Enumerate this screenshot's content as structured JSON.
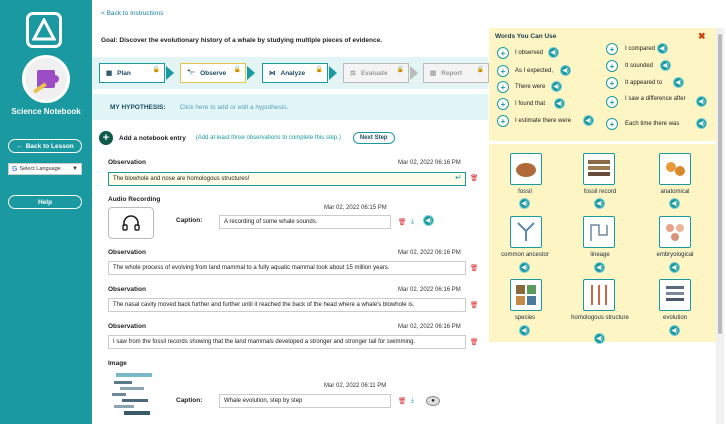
{
  "sidebar": {
    "notebook_title": "Science Notebook",
    "back_to_lesson": "Back to Lesson",
    "language": "Select Language",
    "help": "Help"
  },
  "main": {
    "back_link": "< Back to Instructions",
    "goal": "Goal: Discover the evolutionary history of a whale by studying multiple pieces of evidence.",
    "steps": [
      {
        "label": "Plan",
        "state": "done"
      },
      {
        "label": "Observe",
        "state": "active"
      },
      {
        "label": "Analyze",
        "state": "done"
      },
      {
        "label": "Evaluate",
        "state": "locked"
      },
      {
        "label": "Report",
        "state": "locked"
      }
    ],
    "hypothesis_label": "MY HYPOTHESIS:",
    "hypothesis_placeholder": "Click here to add or edit a hypothesis.",
    "add_entry": "Add a notebook entry",
    "add_note": "(Add at least three observations to complete this step.)",
    "next_step": "Next Step",
    "entries": [
      {
        "title": "Observation",
        "date": "Mar 02, 2022 06:16 PM",
        "text": "The blowhole and nose are homologous structures!"
      },
      {
        "title": "Audio Recording",
        "date": "Mar 02, 2022 06:15 PM",
        "caption_label": "Caption:",
        "caption": "A recording of some whale sounds."
      },
      {
        "title": "Observation",
        "date": "Mar 02, 2022 06:16 PM",
        "text": "The whole process of evolving from land mammal to a fully aquatic mammal took about 15 million years."
      },
      {
        "title": "Observation",
        "date": "Mar 02, 2022 06:16 PM",
        "text": "The nasal cavity moved back further and further until it reached the back of the head where a whale's blowhole is."
      },
      {
        "title": "Observation",
        "date": "Mar 02, 2022 06:16 PM",
        "text": "I saw from the fossil records showing that the land mammals developed a stronger and stronger tail for swimming."
      },
      {
        "title": "Image",
        "date": "Mar 02, 2022 06:11 PM",
        "caption_label": "Caption:",
        "caption": "Whale evolution, step by step"
      }
    ]
  },
  "words": {
    "title": "Words You Can Use",
    "left": [
      "I observed",
      "As I expected,",
      "There were",
      "I found that",
      "I estimate there were"
    ],
    "right": [
      "I compared",
      "It sounded",
      "It appeared to",
      "I saw a difference after",
      "Each time there was"
    ]
  },
  "vocab": [
    {
      "label": "fossil",
      "icon": "fossil-icon"
    },
    {
      "label": "fossil record",
      "icon": "fossil-record-icon"
    },
    {
      "label": "anatomical",
      "icon": "anatomical-icon"
    },
    {
      "label": "common ancestor",
      "icon": "common-ancestor-icon"
    },
    {
      "label": "lineage",
      "icon": "lineage-icon"
    },
    {
      "label": "embryological",
      "icon": "embryological-icon"
    },
    {
      "label": "species",
      "icon": "species-icon"
    },
    {
      "label": "homologous structure",
      "icon": "homologous-structure-icon"
    },
    {
      "label": "evolution",
      "icon": "evolution-icon"
    }
  ],
  "colors": {
    "teal": "#1a9aa0",
    "yellow_panel": "#fdf5c4",
    "accent_gold": "#e6c34c",
    "delete_red": "#dd2222"
  }
}
